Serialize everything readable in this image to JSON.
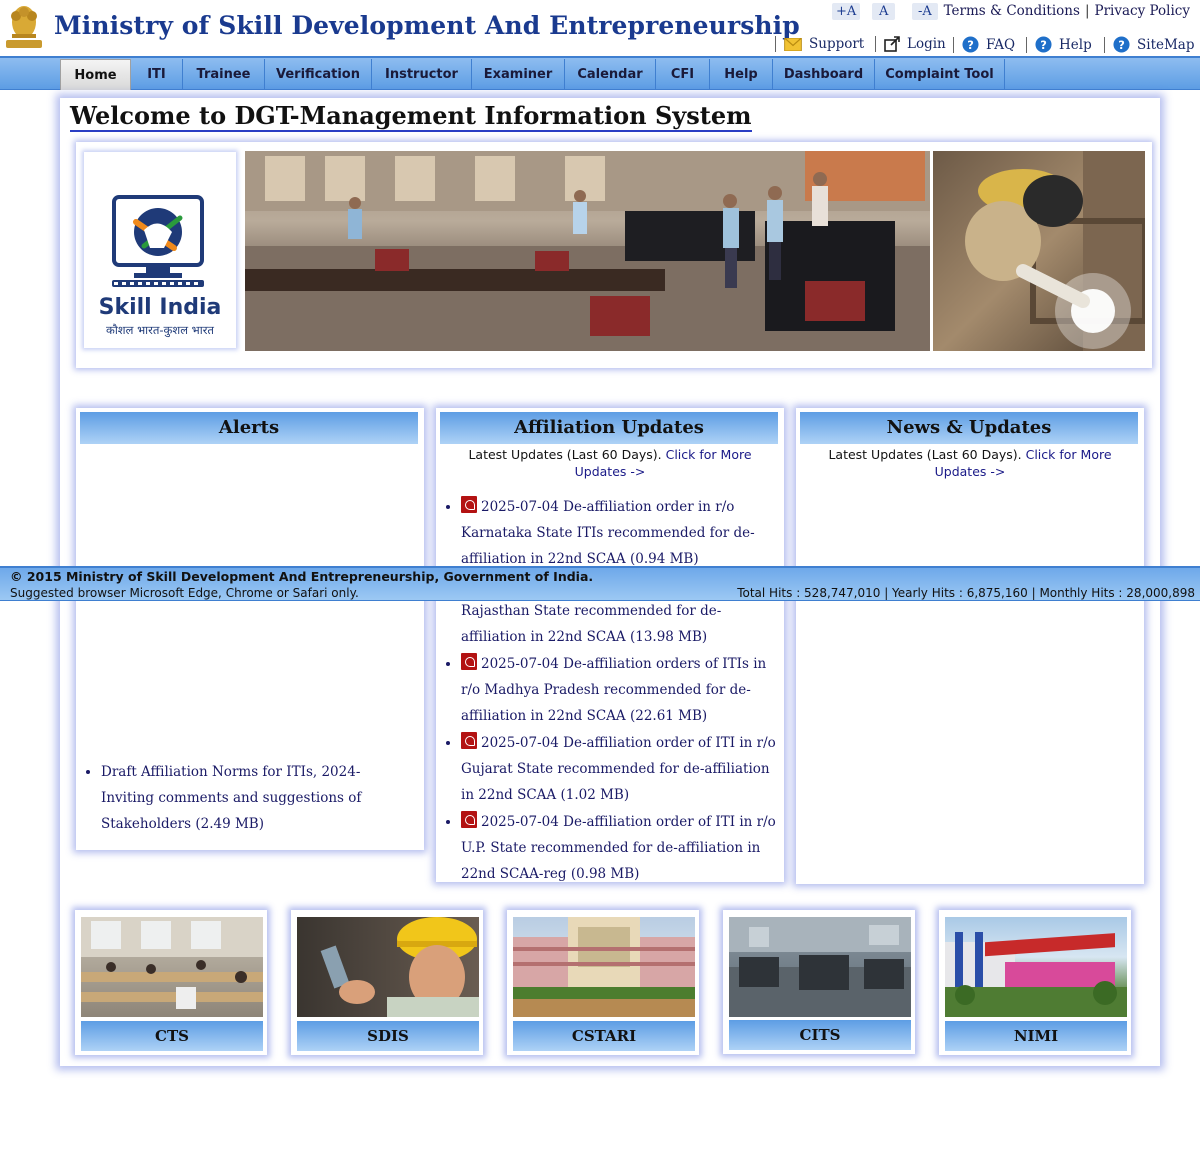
{
  "header": {
    "title": "Ministry of Skill Development And Entrepreneurship",
    "font_controls": [
      "+A",
      "A",
      "-A"
    ],
    "top_links": [
      "Terms & Conditions",
      "Privacy Policy"
    ],
    "utility_links": [
      {
        "label": "Support",
        "icon": "mail-icon"
      },
      {
        "label": "Login",
        "icon": "external-link-icon"
      },
      {
        "label": "FAQ",
        "icon": "question-icon"
      },
      {
        "label": "Help",
        "icon": "question-icon"
      },
      {
        "label": "SiteMap",
        "icon": "question-icon"
      }
    ]
  },
  "nav": {
    "items": [
      "Home",
      "ITI",
      "Trainee",
      "Verification",
      "Instructor",
      "Examiner",
      "Calendar",
      "CFI",
      "Help",
      "Dashboard",
      "Complaint Tool"
    ],
    "active": "Home"
  },
  "welcome": "Welcome to DGT-Management Information System",
  "skill_india": {
    "name": "Skill India",
    "tagline": "कौशल भारत-कुशल भारत"
  },
  "alerts": {
    "title": "Alerts",
    "items": [
      "Draft Affiliation Norms for ITIs, 2024- Inviting comments and suggestions of Stakeholders (2.49 MB)"
    ]
  },
  "affiliation": {
    "title": "Affiliation Updates",
    "latest_text": "Latest Updates (Last 60 Days).",
    "more_text": "Click for More Updates ->",
    "items": [
      "2025-07-04 De-affiliation order in r/o Karnataka State ITIs recommended for de-affiliation in 22nd SCAA (0.94 MB)",
      "Rajasthan State recommended for de-affiliation in 22nd SCAA (13.98 MB)",
      "2025-07-04 De-affiliation orders of ITIs in r/o Madhya Pradesh recommended for de-affiliation in 22nd SCAA (22.61 MB)",
      "2025-07-04 De-affiliation order of ITI in r/o Gujarat State recommended for de-affiliation in 22nd SCAA (1.02 MB)",
      "2025-07-04 De-affiliation order of ITI in r/o U.P. State recommended for de-affiliation in 22nd SCAA-reg (0.98 MB)"
    ]
  },
  "news": {
    "title": "News & Updates",
    "latest_text": "Latest Updates (Last 60 Days).",
    "more_text": "Click for More Updates ->"
  },
  "footer": {
    "copyright": "© 2015 Ministry of Skill Development And Entrepreneurship, Government of India.",
    "browser_note": "Suggested browser Microsoft Edge, Chrome or Safari only.",
    "hits": "Total Hits : 528,747,010 | Yearly Hits : 6,875,160 | Monthly Hits : 28,000,898"
  },
  "tiles": [
    "CTS",
    "SDIS",
    "CSTARI",
    "CITS",
    "NIMI"
  ],
  "colors": {
    "title_blue": "#1a3a8f",
    "nav_blue": "#5d9de4",
    "pdf_red": "#b31212"
  }
}
